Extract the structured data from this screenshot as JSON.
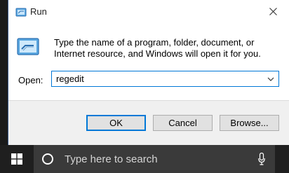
{
  "dialog": {
    "title": "Run",
    "description": "Type the name of a program, folder, document, or Internet resource, and Windows will open it for you.",
    "open_label": "Open:",
    "open_value": "regedit",
    "buttons": {
      "ok": "OK",
      "cancel": "Cancel",
      "browse": "Browse..."
    },
    "icons": {
      "title": "run-icon",
      "close": "close-icon",
      "main": "run-icon",
      "dropdown": "chevron-down-icon"
    }
  },
  "taskbar": {
    "search_placeholder": "Type here to search",
    "icons": {
      "start": "windows-logo-icon",
      "search": "cortana-circle-icon",
      "mic": "microphone-icon"
    }
  },
  "colors": {
    "accent": "#0078d7",
    "taskbar": "#1f1f1f",
    "search_box": "#3a3a3a",
    "button_face": "#e1e1e1",
    "dialog_footer": "#f0f0f0"
  }
}
